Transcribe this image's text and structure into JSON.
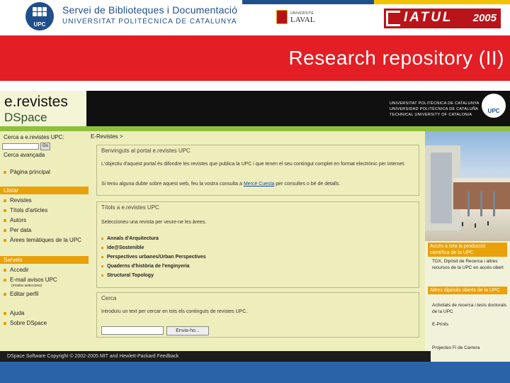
{
  "slide": {
    "title": "Research repository (II)",
    "logos": {
      "library_line1": "Servei de Biblioteques i Documentació",
      "library_line2": "UNIVERSITAT POLITÈCNICA DE CATALUNYA",
      "upc_abbrev": "UPC",
      "laval_top": "UNIVERSITÉ",
      "laval_name": "LAVAL",
      "iatul_text": "IATUL",
      "iatul_year": "2005"
    }
  },
  "site": {
    "logo_line1": "e.revistes",
    "logo_line2": "DSpace",
    "uni_names": [
      "UNIVERSITAT POLITÈCNICA DE CATALUNYA",
      "UNIVERSIDAD POLITÉCNICA DE CATALUÑA",
      "TECHNICAL UNIVERSITY OF CATALONIA"
    ],
    "seal_label": "UPC"
  },
  "sidebar": {
    "search_label": "Cerca a e.revistes UPC:",
    "go_label": "Go",
    "advanced_search": "Cerca avançada",
    "home": "Pàgina principal",
    "browse_header": "Llistar",
    "browse_items": [
      "Revistes",
      "Títols d'articles",
      "Autors",
      "Per data",
      "Àrees temàtiques de la UPC"
    ],
    "services_header": "Serveis",
    "service_items": [
      "Accedir",
      "E-mail avisos UPC",
      "Editar perfil"
    ],
    "service_note": "(mostra seleccions)",
    "help_items": [
      "Ajuda",
      "Sobre DSpace"
    ]
  },
  "main": {
    "breadcrumb": "E-Revistes >",
    "welcome_title": "Benvinguts al portal e.revistes UPC",
    "welcome_p1": "L'objectiu d'aquest portal és difondre les revistes que publica la UPC i que tenen el seu contingut complet en format electrònic per internet.",
    "welcome_p2": "Si teniu alguna dubte sobre aquest web, feu la vostra consulta a",
    "welcome_link": "Mercè Cuesta",
    "welcome_p2_end": "per consultes o bé de detalls.",
    "titles_title": "Títols a e.revistes UPC",
    "titles_intro": "Seleccioneu una revista per veure-ne les àrees.",
    "journals": [
      "Annals d'Arquitectura",
      "Ide@Sostenible",
      "Perspectives urbanes/Urban Perspectives",
      "Quaderns d'història de l'enginyeria",
      "Structural Topology"
    ],
    "search_title": "Cerca",
    "search_text": "Introduïu un text per cercar en tots els continguts de revistes UPC.",
    "search_button": "Envia-ho..."
  },
  "right_col": {
    "access_header": "Accés a tota la producció científica de la UPC",
    "access_text": "TDX, Dipòsit de Recerca i altres recursos de la UPC en accés obert",
    "other_header": "Altres dipòsits oberts de la UPC",
    "other_text": "Activitats de recerca i tesis doctorals de la UPC",
    "other_text2": "E-Prints",
    "footer_link": "Projectes Fi de Carrera"
  },
  "footer": {
    "text": "DSpace Software   Copyright © 2002-2005 MIT and Hewlett-Packard   Feedback"
  },
  "colors": {
    "title_red": "#e31e24",
    "upc_blue": "#1f4e8c",
    "sidebar_bg": "#eeeebc",
    "orange_header": "#e8a10a",
    "green_line": "#8fbf3c"
  }
}
